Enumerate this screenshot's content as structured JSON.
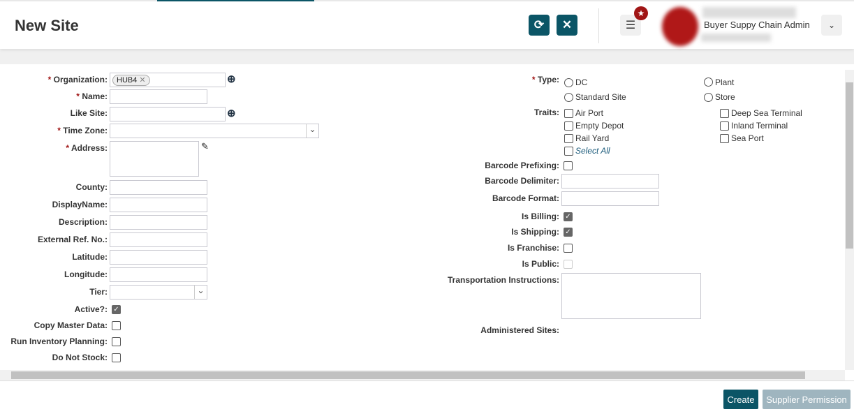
{
  "header": {
    "title": "New Site",
    "refresh_icon": "refresh-icon",
    "close_icon": "close-icon",
    "menu_icon": "hamburger-icon",
    "user_role": "Buyer Suppy Chain Admin"
  },
  "left": {
    "organization": {
      "label": "Organization:",
      "value": "HUB4"
    },
    "name": "Name:",
    "like_site": "Like Site:",
    "time_zone": "Time Zone:",
    "address": "Address:",
    "county": "County:",
    "display_name": "DisplayName:",
    "description": "Description:",
    "ext_ref": "External Ref. No.:",
    "latitude": "Latitude:",
    "longitude": "Longitude:",
    "tier": "Tier:",
    "active": "Active?:",
    "copy_master": "Copy Master Data:",
    "run_inventory": "Run Inventory Planning:",
    "do_not_stock": "Do Not Stock:",
    "required_mark": "*"
  },
  "right": {
    "type": {
      "label": "Type:",
      "options": [
        "DC",
        "Plant",
        "Standard Site",
        "Store"
      ]
    },
    "traits": {
      "label": "Traits:",
      "options": [
        "Air Port",
        "Empty Depot",
        "Rail Yard",
        "Deep Sea Terminal",
        "Inland Terminal",
        "Sea Port"
      ],
      "select_all": "Select All"
    },
    "barcode_prefixing": "Barcode Prefixing:",
    "barcode_delimiter": "Barcode Delimiter:",
    "barcode_format": "Barcode Format:",
    "is_billing": "Is Billing:",
    "is_shipping": "Is Shipping:",
    "is_franchise": "Is Franchise:",
    "is_public": "Is Public:",
    "transportation": "Transportation Instructions:",
    "administered": "Administered Sites:"
  },
  "footer": {
    "create": "Create",
    "supplier_permission": "Supplier Permission"
  }
}
